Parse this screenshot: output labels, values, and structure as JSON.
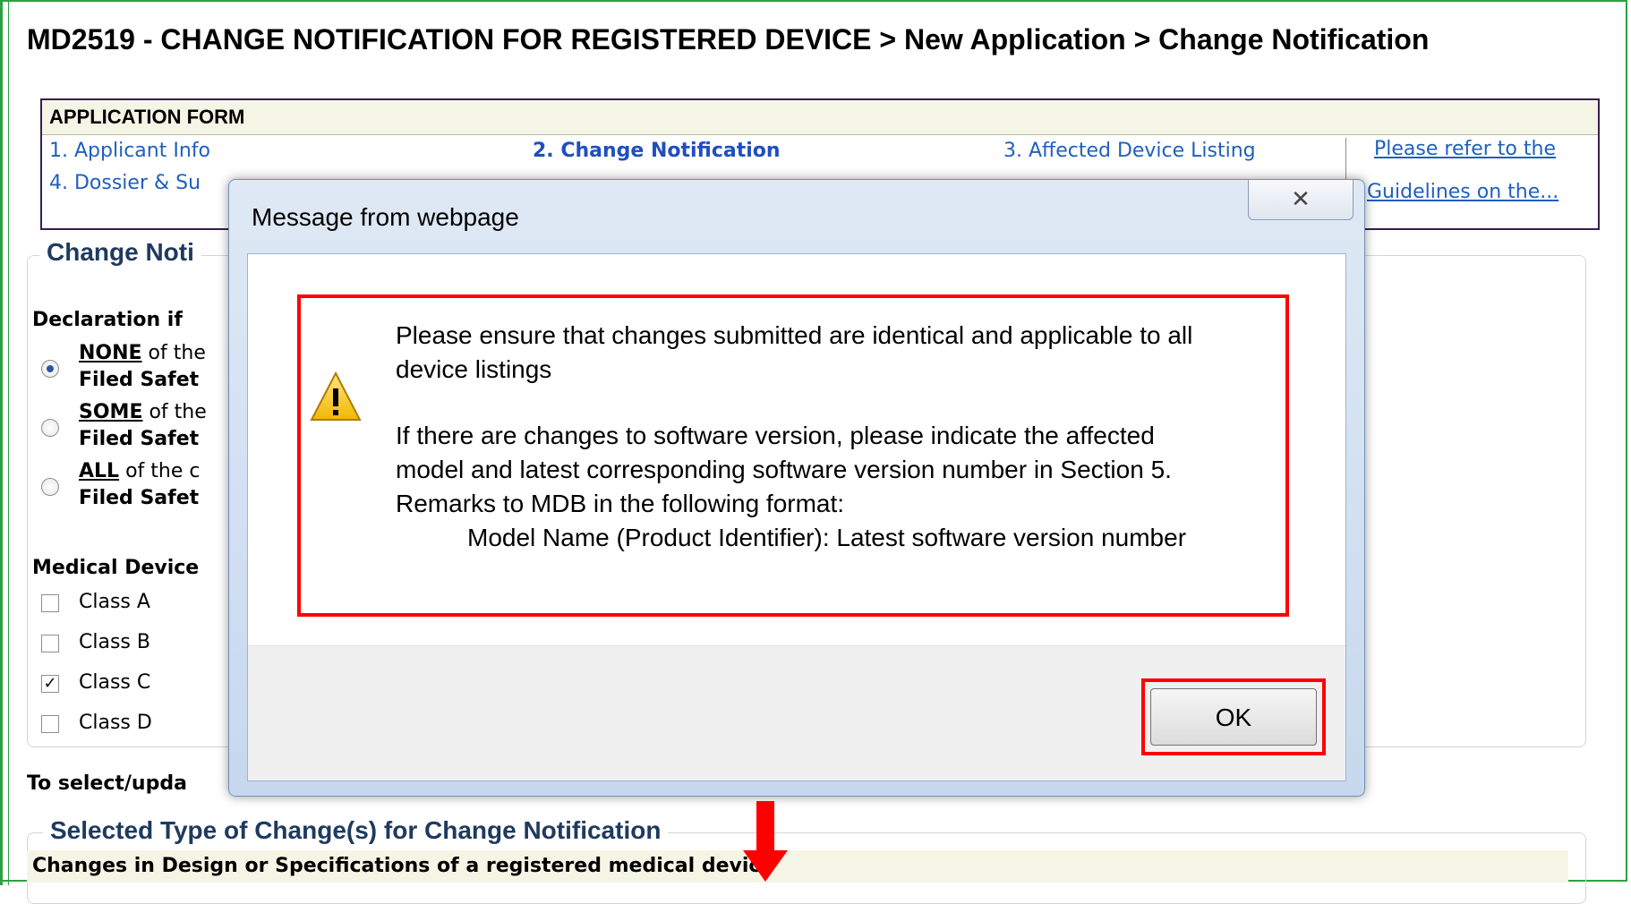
{
  "page_title": "MD2519 - CHANGE NOTIFICATION FOR REGISTERED DEVICE > New Application > Change Notification",
  "application_form": {
    "header": "APPLICATION FORM",
    "steps": [
      "1. Applicant Info",
      "2. Change Notification",
      "3. Affected Device Listing",
      "4. Dossier & Su"
    ],
    "guide_link": [
      "Please refer to the",
      "Guidelines on the..."
    ]
  },
  "change_notification_section": {
    "legend": "Change Noti",
    "declaration_label": "Declaration if",
    "options": [
      {
        "key": "NONE",
        "rest": " of the",
        "line2": "Filed Safet",
        "selected": true
      },
      {
        "key": "SOME",
        "rest": " of the",
        "line2": "Filed Safet",
        "selected": false
      },
      {
        "key": "ALL",
        "rest": " of the c",
        "line2": "Filed Safet",
        "selected": false
      }
    ],
    "medical_device_label": "Medical Device",
    "classes": [
      {
        "label": "Class A",
        "checked": false
      },
      {
        "label": "Class B",
        "checked": false
      },
      {
        "label": "Class C",
        "checked": true
      },
      {
        "label": "Class D",
        "checked": false
      }
    ]
  },
  "select_update_text": "To select/upda",
  "selected_type": {
    "legend": "Selected Type of Change(s) for Change Notification",
    "row": "Changes in Design or Specifications of a registered medical device"
  },
  "dialog": {
    "title": "Message from webpage",
    "close_glyph": "✕",
    "message_lines": [
      "Please ensure that changes submitted are identical and applicable to all",
      "device listings",
      "If there are changes to software version, please indicate the affected",
      "model and latest corresponding software version number in Section 5.",
      "Remarks to MDB in the following format:",
      "Model Name (Product Identifier): Latest software version number"
    ],
    "ok_label": "OK"
  },
  "colors": {
    "highlight": "#ff0000",
    "frame": "#2ea043",
    "link": "#1f5fbf"
  }
}
